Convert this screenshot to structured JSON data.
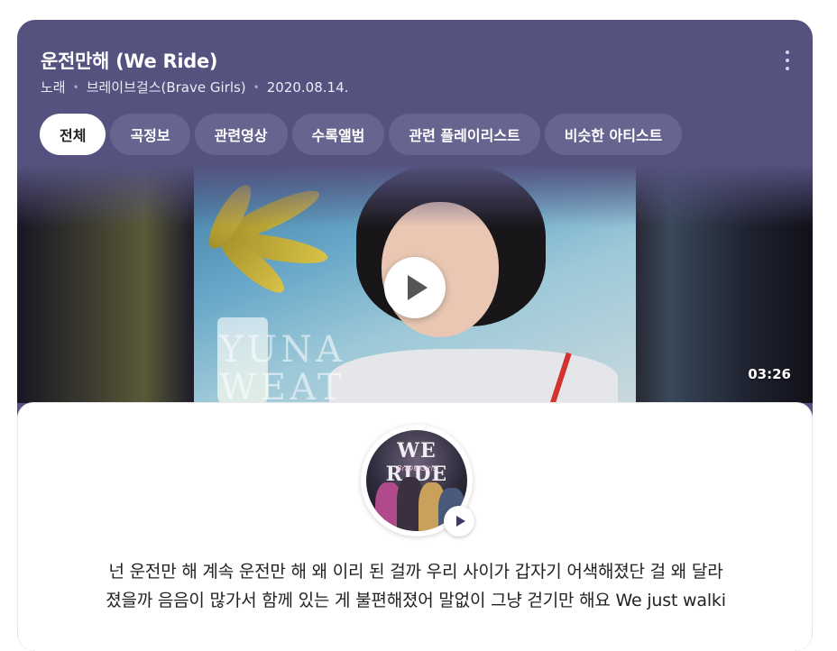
{
  "song": {
    "title": "운전만해 (We Ride)",
    "type": "노래",
    "artist": "브레이브걸스(Brave Girls)",
    "date": "2020.08.14."
  },
  "tabs": [
    {
      "label": "전체",
      "active": true
    },
    {
      "label": "곡정보"
    },
    {
      "label": "관련영상"
    },
    {
      "label": "수록앨범"
    },
    {
      "label": "관련 플레이리스트"
    },
    {
      "label": "비슷한 아티스트"
    }
  ],
  "video": {
    "duration": "03:26",
    "watermark_line1": "YUNA",
    "watermark_line2": "WEAT"
  },
  "album": {
    "cover_title": "WE RIDE",
    "cover_subtitle": "Brave Girls"
  },
  "lyrics": {
    "line1": "넌 운전만 해 계속 운전만 해 왜 이리 된 걸까 우리 사이가 갑자기 어색해졌단 걸 왜 달라",
    "line2": "졌을까 음음이 많가서 함께 있는 게 불편해졌어 말없이 그냥 걷기만 해요 We just walki"
  },
  "colors": {
    "header_bg": "#55527f",
    "tab_bg": "#67648f",
    "active_tab_bg": "#ffffff"
  }
}
